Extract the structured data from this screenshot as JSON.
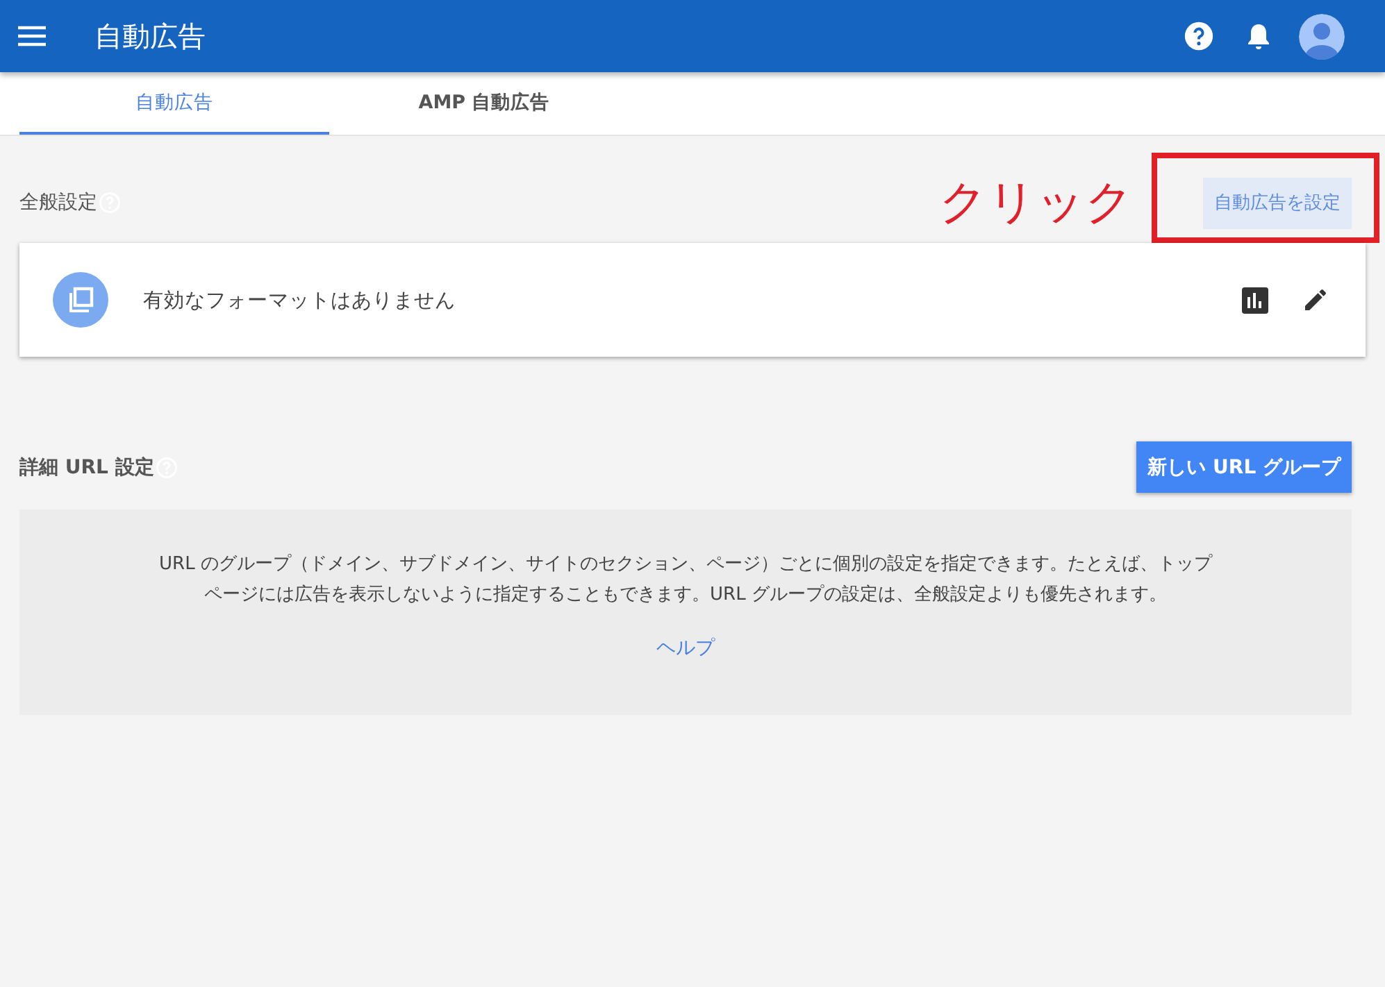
{
  "app_bar": {
    "title": "自動広告"
  },
  "tabs": [
    {
      "label": "自動広告",
      "selected": true
    },
    {
      "label": "AMP 自動広告",
      "selected": false
    }
  ],
  "general_settings": {
    "heading": "全般設定",
    "annotation": "クリック",
    "button": "自動広告を設定",
    "card": {
      "message": "有効なフォーマットはありません"
    }
  },
  "url_settings": {
    "heading": "詳細 URL 設定",
    "button": "新しい URL グループ",
    "description": "URL のグループ（ドメイン、サブドメイン、サイトのセクション、ページ）ごとに個別の設定を指定できます。たとえば、トップページには広告を表示しないように指定することもできます。URL グループの設定は、全般設定よりも優先されます。",
    "help_link": "ヘルプ"
  }
}
